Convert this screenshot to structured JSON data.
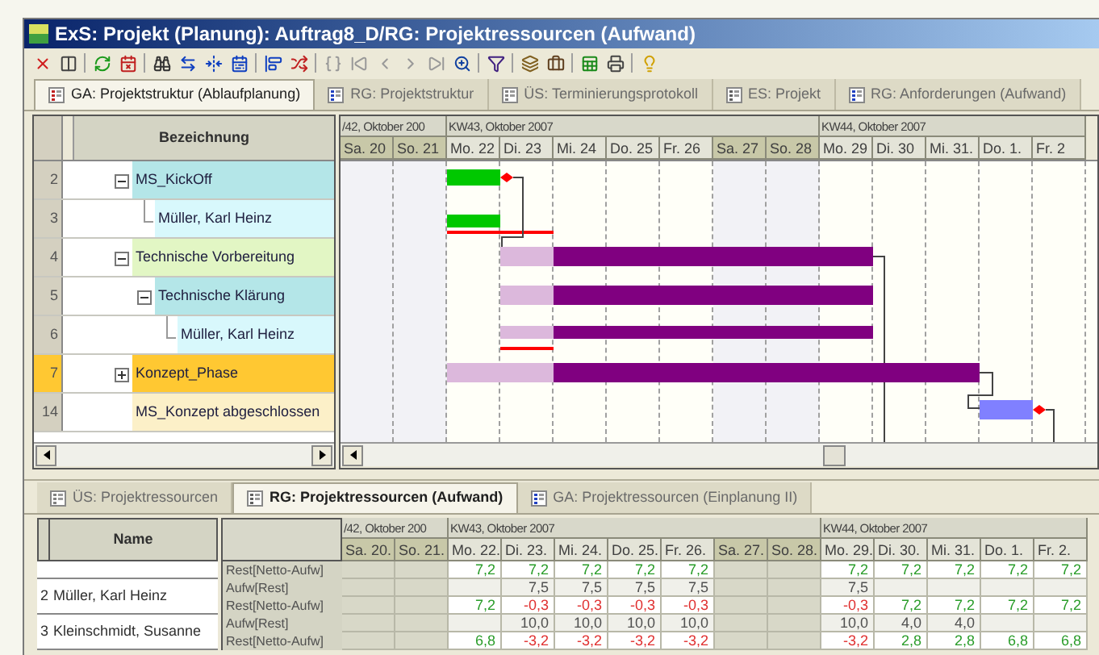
{
  "window": {
    "title": "ExS: Projekt (Planung): Auftrag8_D/RG: Projektressourcen (Aufwand)"
  },
  "tabs": [
    {
      "label": "GA: Projektstruktur (Ablaufplanung)",
      "selected": true
    },
    {
      "label": "RG: Projektstruktur",
      "selected": false
    },
    {
      "label": "ÜS: Terminierungsprotokoll",
      "selected": false
    },
    {
      "label": "ES: Projekt",
      "selected": false
    },
    {
      "label": "RG: Anforderungen (Aufwand)",
      "selected": false
    }
  ],
  "tree": {
    "header": "Bezeichnung",
    "rows": [
      {
        "number": "2",
        "label": "MS_KickOff",
        "color": "#b4e6e8",
        "expanded": true,
        "selected": false,
        "children": [
          {
            "number": "3",
            "label": "Müller, Karl Heinz",
            "color": "#d8f8fc",
            "selected": false
          }
        ]
      },
      {
        "number": "4",
        "label": "Technische Vorbereitung",
        "color": "#e2f6c4",
        "expanded": true,
        "selected": false,
        "children": [
          {
            "number": "5",
            "label": "Technische Klärung",
            "color": "#b4e6e8",
            "expanded": true,
            "selected": false,
            "children": [
              {
                "number": "6",
                "label": "Müller, Karl Heinz",
                "color": "#d8f8fc",
                "selected": false
              }
            ]
          }
        ]
      },
      {
        "number": "7",
        "label": "Konzept_Phase",
        "color": "#ffc832",
        "expanded": false,
        "selected": true
      },
      {
        "number": "14",
        "label": "MS_Konzept abgeschlossen",
        "color": "#fcf0c8",
        "selected": false
      }
    ]
  },
  "gantt": {
    "weeks": [
      {
        "label": "/42, Oktober 200",
        "days": [
          {
            "label": "Sa. 20",
            "weekend": true
          },
          {
            "label": "So. 21",
            "weekend": true
          }
        ]
      },
      {
        "label": "KW43, Oktober 2007",
        "days": [
          {
            "label": "Mo. 22",
            "weekend": false
          },
          {
            "label": "Di. 23",
            "weekend": false
          },
          {
            "label": "Mi. 24",
            "weekend": false
          },
          {
            "label": "Do. 25",
            "weekend": false
          },
          {
            "label": "Fr. 26",
            "weekend": false
          },
          {
            "label": "Sa. 27",
            "weekend": true
          },
          {
            "label": "So. 28",
            "weekend": true
          }
        ]
      },
      {
        "label": "KW44, Oktober 2007",
        "days": [
          {
            "label": "Mo. 29",
            "weekend": false
          },
          {
            "label": "Di. 30",
            "weekend": false
          },
          {
            "label": "Mi. 31.",
            "weekend": false
          },
          {
            "label": "Do. 1.",
            "weekend": false
          },
          {
            "label": "Fr. 2",
            "weekend": false
          }
        ]
      }
    ]
  },
  "bottom_tabs": [
    {
      "label": "ÜS: Projektressourcen",
      "selected": false
    },
    {
      "label": "RG: Projektressourcen (Aufwand)",
      "selected": true
    },
    {
      "label": "GA: Projektressourcen (Einplanung II)",
      "selected": false
    }
  ],
  "resource_table": {
    "name_header": "Name",
    "weeks": [
      {
        "label": "/42, Oktober 200",
        "days": [
          {
            "label": "Sa. 20.",
            "weekend": true
          },
          {
            "label": "So. 21.",
            "weekend": true
          }
        ]
      },
      {
        "label": "KW43, Oktober 2007",
        "days": [
          {
            "label": "Mo. 22.",
            "weekend": false
          },
          {
            "label": "Di. 23.",
            "weekend": false
          },
          {
            "label": "Mi. 24.",
            "weekend": false
          },
          {
            "label": "Do. 25.",
            "weekend": false
          },
          {
            "label": "Fr. 26.",
            "weekend": false
          },
          {
            "label": "Sa. 27.",
            "weekend": true
          },
          {
            "label": "So. 28.",
            "weekend": true
          }
        ]
      },
      {
        "label": "KW44, Oktober 2007",
        "days": [
          {
            "label": "Mo. 29.",
            "weekend": false
          },
          {
            "label": "Di. 30.",
            "weekend": false
          },
          {
            "label": "Mi. 31.",
            "weekend": false
          },
          {
            "label": "Do. 1.",
            "weekend": false
          },
          {
            "label": "Fr. 2.",
            "weekend": false
          }
        ]
      }
    ],
    "resources": [
      {
        "lines": [
          {
            "measure": "Rest[Netto-Aufw]",
            "kind": "rest",
            "values": [
              {
                "kind": "empty"
              },
              {
                "kind": "empty"
              },
              {
                "kind": "value",
                "text": "7,2",
                "color": "#2a9d2a"
              },
              {
                "kind": "value",
                "text": "7,2",
                "color": "#2a9d2a"
              },
              {
                "kind": "value",
                "text": "7,2",
                "color": "#2a9d2a"
              },
              {
                "kind": "value",
                "text": "7,2",
                "color": "#2a9d2a"
              },
              {
                "kind": "value",
                "text": "7,2",
                "color": "#2a9d2a"
              },
              {
                "kind": "empty"
              },
              {
                "kind": "empty"
              },
              {
                "kind": "value",
                "text": "7,2",
                "color": "#2a9d2a"
              },
              {
                "kind": "value",
                "text": "7,2",
                "color": "#2a9d2a"
              },
              {
                "kind": "value",
                "text": "7,2",
                "color": "#2a9d2a"
              },
              {
                "kind": "value",
                "text": "7,2",
                "color": "#2a9d2a"
              },
              {
                "kind": "value",
                "text": "7,2",
                "color": "#2a9d2a"
              }
            ]
          }
        ]
      },
      {
        "number": "2",
        "name": "Müller, Karl Heinz",
        "lines": [
          {
            "measure": "Aufw[Rest]",
            "kind": "effort",
            "values": [
              {
                "kind": "empty"
              },
              {
                "kind": "empty"
              },
              {
                "kind": "empty"
              },
              {
                "kind": "value",
                "text": "7,5",
                "color": "#505050"
              },
              {
                "kind": "value",
                "text": "7,5",
                "color": "#505050"
              },
              {
                "kind": "value",
                "text": "7,5",
                "color": "#505050"
              },
              {
                "kind": "value",
                "text": "7,5",
                "color": "#505050"
              },
              {
                "kind": "empty"
              },
              {
                "kind": "empty"
              },
              {
                "kind": "value",
                "text": "7,5",
                "color": "#505050"
              },
              {
                "kind": "empty"
              },
              {
                "kind": "empty"
              },
              {
                "kind": "empty"
              },
              {
                "kind": "empty"
              }
            ]
          },
          {
            "measure": "Rest[Netto-Aufw]",
            "kind": "rest",
            "values": [
              {
                "kind": "empty"
              },
              {
                "kind": "empty"
              },
              {
                "kind": "value",
                "text": "7,2",
                "color": "#2a9d2a"
              },
              {
                "kind": "value",
                "text": "-0,3",
                "color": "#e03030"
              },
              {
                "kind": "value",
                "text": "-0,3",
                "color": "#e03030"
              },
              {
                "kind": "value",
                "text": "-0,3",
                "color": "#e03030"
              },
              {
                "kind": "value",
                "text": "-0,3",
                "color": "#e03030"
              },
              {
                "kind": "empty"
              },
              {
                "kind": "empty"
              },
              {
                "kind": "value",
                "text": "-0,3",
                "color": "#e03030"
              },
              {
                "kind": "value",
                "text": "7,2",
                "color": "#2a9d2a"
              },
              {
                "kind": "value",
                "text": "7,2",
                "color": "#2a9d2a"
              },
              {
                "kind": "value",
                "text": "7,2",
                "color": "#2a9d2a"
              },
              {
                "kind": "value",
                "text": "7,2",
                "color": "#2a9d2a"
              }
            ]
          }
        ]
      },
      {
        "number": "3",
        "name": "Kleinschmidt, Susanne",
        "lines": [
          {
            "measure": "Aufw[Rest]",
            "kind": "effort",
            "values": [
              {
                "kind": "empty"
              },
              {
                "kind": "empty"
              },
              {
                "kind": "empty"
              },
              {
                "kind": "value",
                "text": "10,0",
                "color": "#505050"
              },
              {
                "kind": "value",
                "text": "10,0",
                "color": "#505050"
              },
              {
                "kind": "value",
                "text": "10,0",
                "color": "#505050"
              },
              {
                "kind": "value",
                "text": "10,0",
                "color": "#505050"
              },
              {
                "kind": "empty"
              },
              {
                "kind": "empty"
              },
              {
                "kind": "value",
                "text": "10,0",
                "color": "#505050"
              },
              {
                "kind": "value",
                "text": "4,0",
                "color": "#505050"
              },
              {
                "kind": "value",
                "text": "4,0",
                "color": "#505050"
              },
              {
                "kind": "empty"
              },
              {
                "kind": "empty"
              }
            ]
          },
          {
            "measure": "Rest[Netto-Aufw]",
            "kind": "rest",
            "values": [
              {
                "kind": "empty"
              },
              {
                "kind": "empty"
              },
              {
                "kind": "value",
                "text": "6,8",
                "color": "#2a9d2a"
              },
              {
                "kind": "value",
                "text": "-3,2",
                "color": "#e03030"
              },
              {
                "kind": "value",
                "text": "-3,2",
                "color": "#e03030"
              },
              {
                "kind": "value",
                "text": "-3,2",
                "color": "#e03030"
              },
              {
                "kind": "value",
                "text": "-3,2",
                "color": "#e03030"
              },
              {
                "kind": "empty"
              },
              {
                "kind": "empty"
              },
              {
                "kind": "value",
                "text": "-3,2",
                "color": "#e03030"
              },
              {
                "kind": "value",
                "text": "2,8",
                "color": "#2a9d2a"
              },
              {
                "kind": "value",
                "text": "2,8",
                "color": "#2a9d2a"
              },
              {
                "kind": "value",
                "text": "6,8",
                "color": "#2a9d2a"
              },
              {
                "kind": "value",
                "text": "6,8",
                "color": "#2a9d2a"
              }
            ]
          }
        ]
      }
    ]
  }
}
